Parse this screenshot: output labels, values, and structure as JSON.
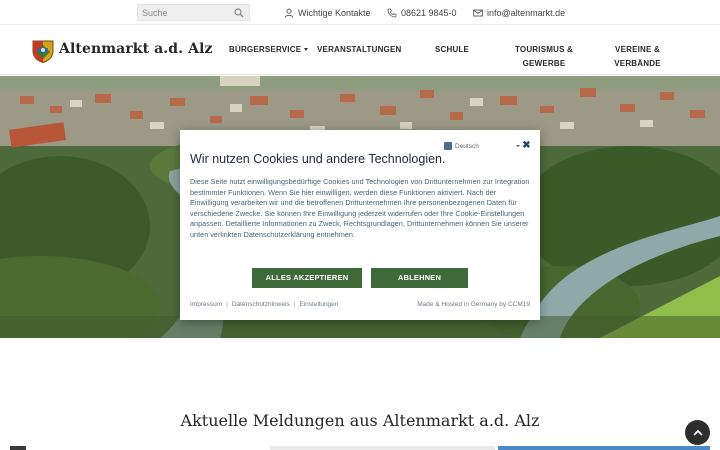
{
  "topbar": {
    "search_placeholder": "Suche",
    "contacts_label": "Wichtige Kontakte",
    "phone_label": "08621 9845-0",
    "email_label": "info@altenmarkt.de"
  },
  "header": {
    "brand": "Altenmarkt a.d. Alz",
    "nav": [
      {
        "label": "Bürgerservice",
        "has_dropdown": true
      },
      {
        "label": "Veranstaltungen"
      },
      {
        "label": "Schule"
      },
      {
        "label": "Tourismus & Gewerbe"
      },
      {
        "label": "Vereine & Verbände"
      }
    ]
  },
  "cookie": {
    "language": "Deutsch",
    "title": "Wir nutzen Cookies und andere Technologien.",
    "text": "Diese Seite nutzt einwilligungsbedürftige Cookies und Technologien von Drittunternehmen zur Integration bestimmter Funktionen. Wenn Sie hier einwilligen, werden diese Funktionen aktiviert. Nach der Einwilligung verarbeiten wir und die betroffenen Drittunternehmen Ihre personenbezogenen Daten für verschiedene Zwecke. Sie können Ihre Einwilligung jederzeit widerrufen oder Ihre Cookie-Einstellungen anpassen. Detaillierte Informationen zu Zweck, Rechtsgrundlagen, Drittunternehmen können Sie unserer unten verlinkten Datenschutzerklärung entnehmen.",
    "accept_label": "Alles akzeptieren",
    "decline_label": "Ablehnen",
    "links": [
      "Impressum",
      "Datenschutzhinweis",
      "Einstellungen"
    ],
    "made_by": "Made & Hosted in Germany by CCM19"
  },
  "news": {
    "title": "Aktuelle Meldungen aus Altenmarkt a.d. Alz"
  },
  "colors": {
    "accent_green": "#3e6a39",
    "dialog_title": "#1f2a3a"
  }
}
